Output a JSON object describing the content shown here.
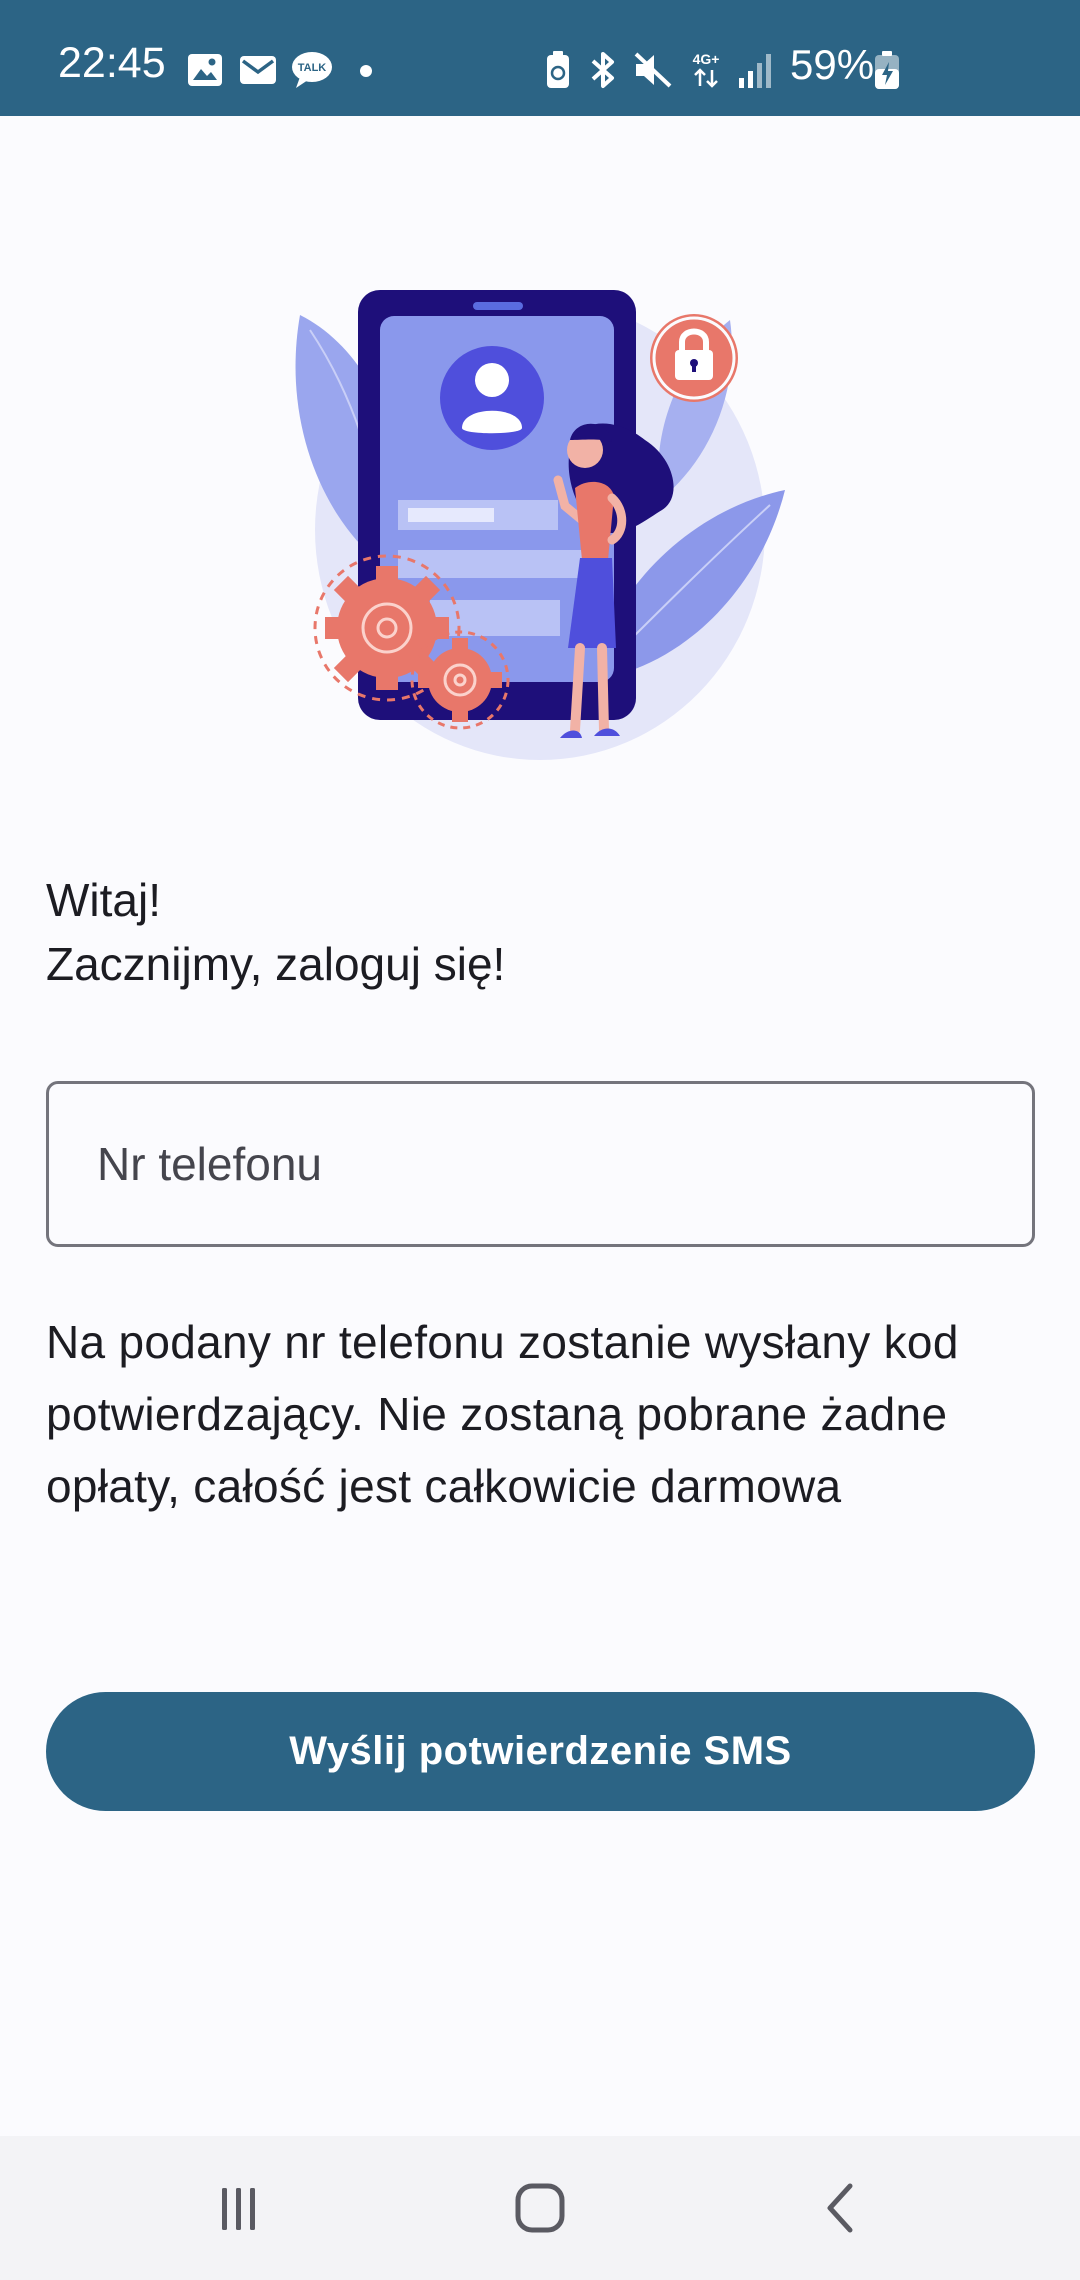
{
  "status_bar": {
    "time": "22:45",
    "battery_percent": "59%",
    "network_label": "4G+",
    "talk_label": "TALK",
    "icons": [
      "gallery-icon",
      "mail-icon",
      "talk-icon",
      "dot-icon",
      "battery-saver-icon",
      "bluetooth-icon",
      "mute-icon",
      "network-4g-icon",
      "signal-icon",
      "battery-icon"
    ]
  },
  "login": {
    "greeting_line1": "Witaj!",
    "greeting_line2": "Zacznijmy, zaloguj się!",
    "phone_placeholder": "Nr telefonu",
    "phone_value": "",
    "info": "Na podany nr telefonu zostanie wysłany kod potwierdzający. Nie zostaną pobrane żadne opłaty, całość jest całkowicie darmowa",
    "submit_label": "Wyślij potwierdzenie SMS"
  },
  "nav_bar": {
    "icons": [
      "recent-apps-icon",
      "home-icon",
      "back-icon"
    ]
  },
  "colors": {
    "primary": "#2c6485",
    "background": "#fbfbfe",
    "text": "#1c1c22",
    "illustration_accent": "#e8776a",
    "illustration_purple": "#1e0f7a"
  }
}
